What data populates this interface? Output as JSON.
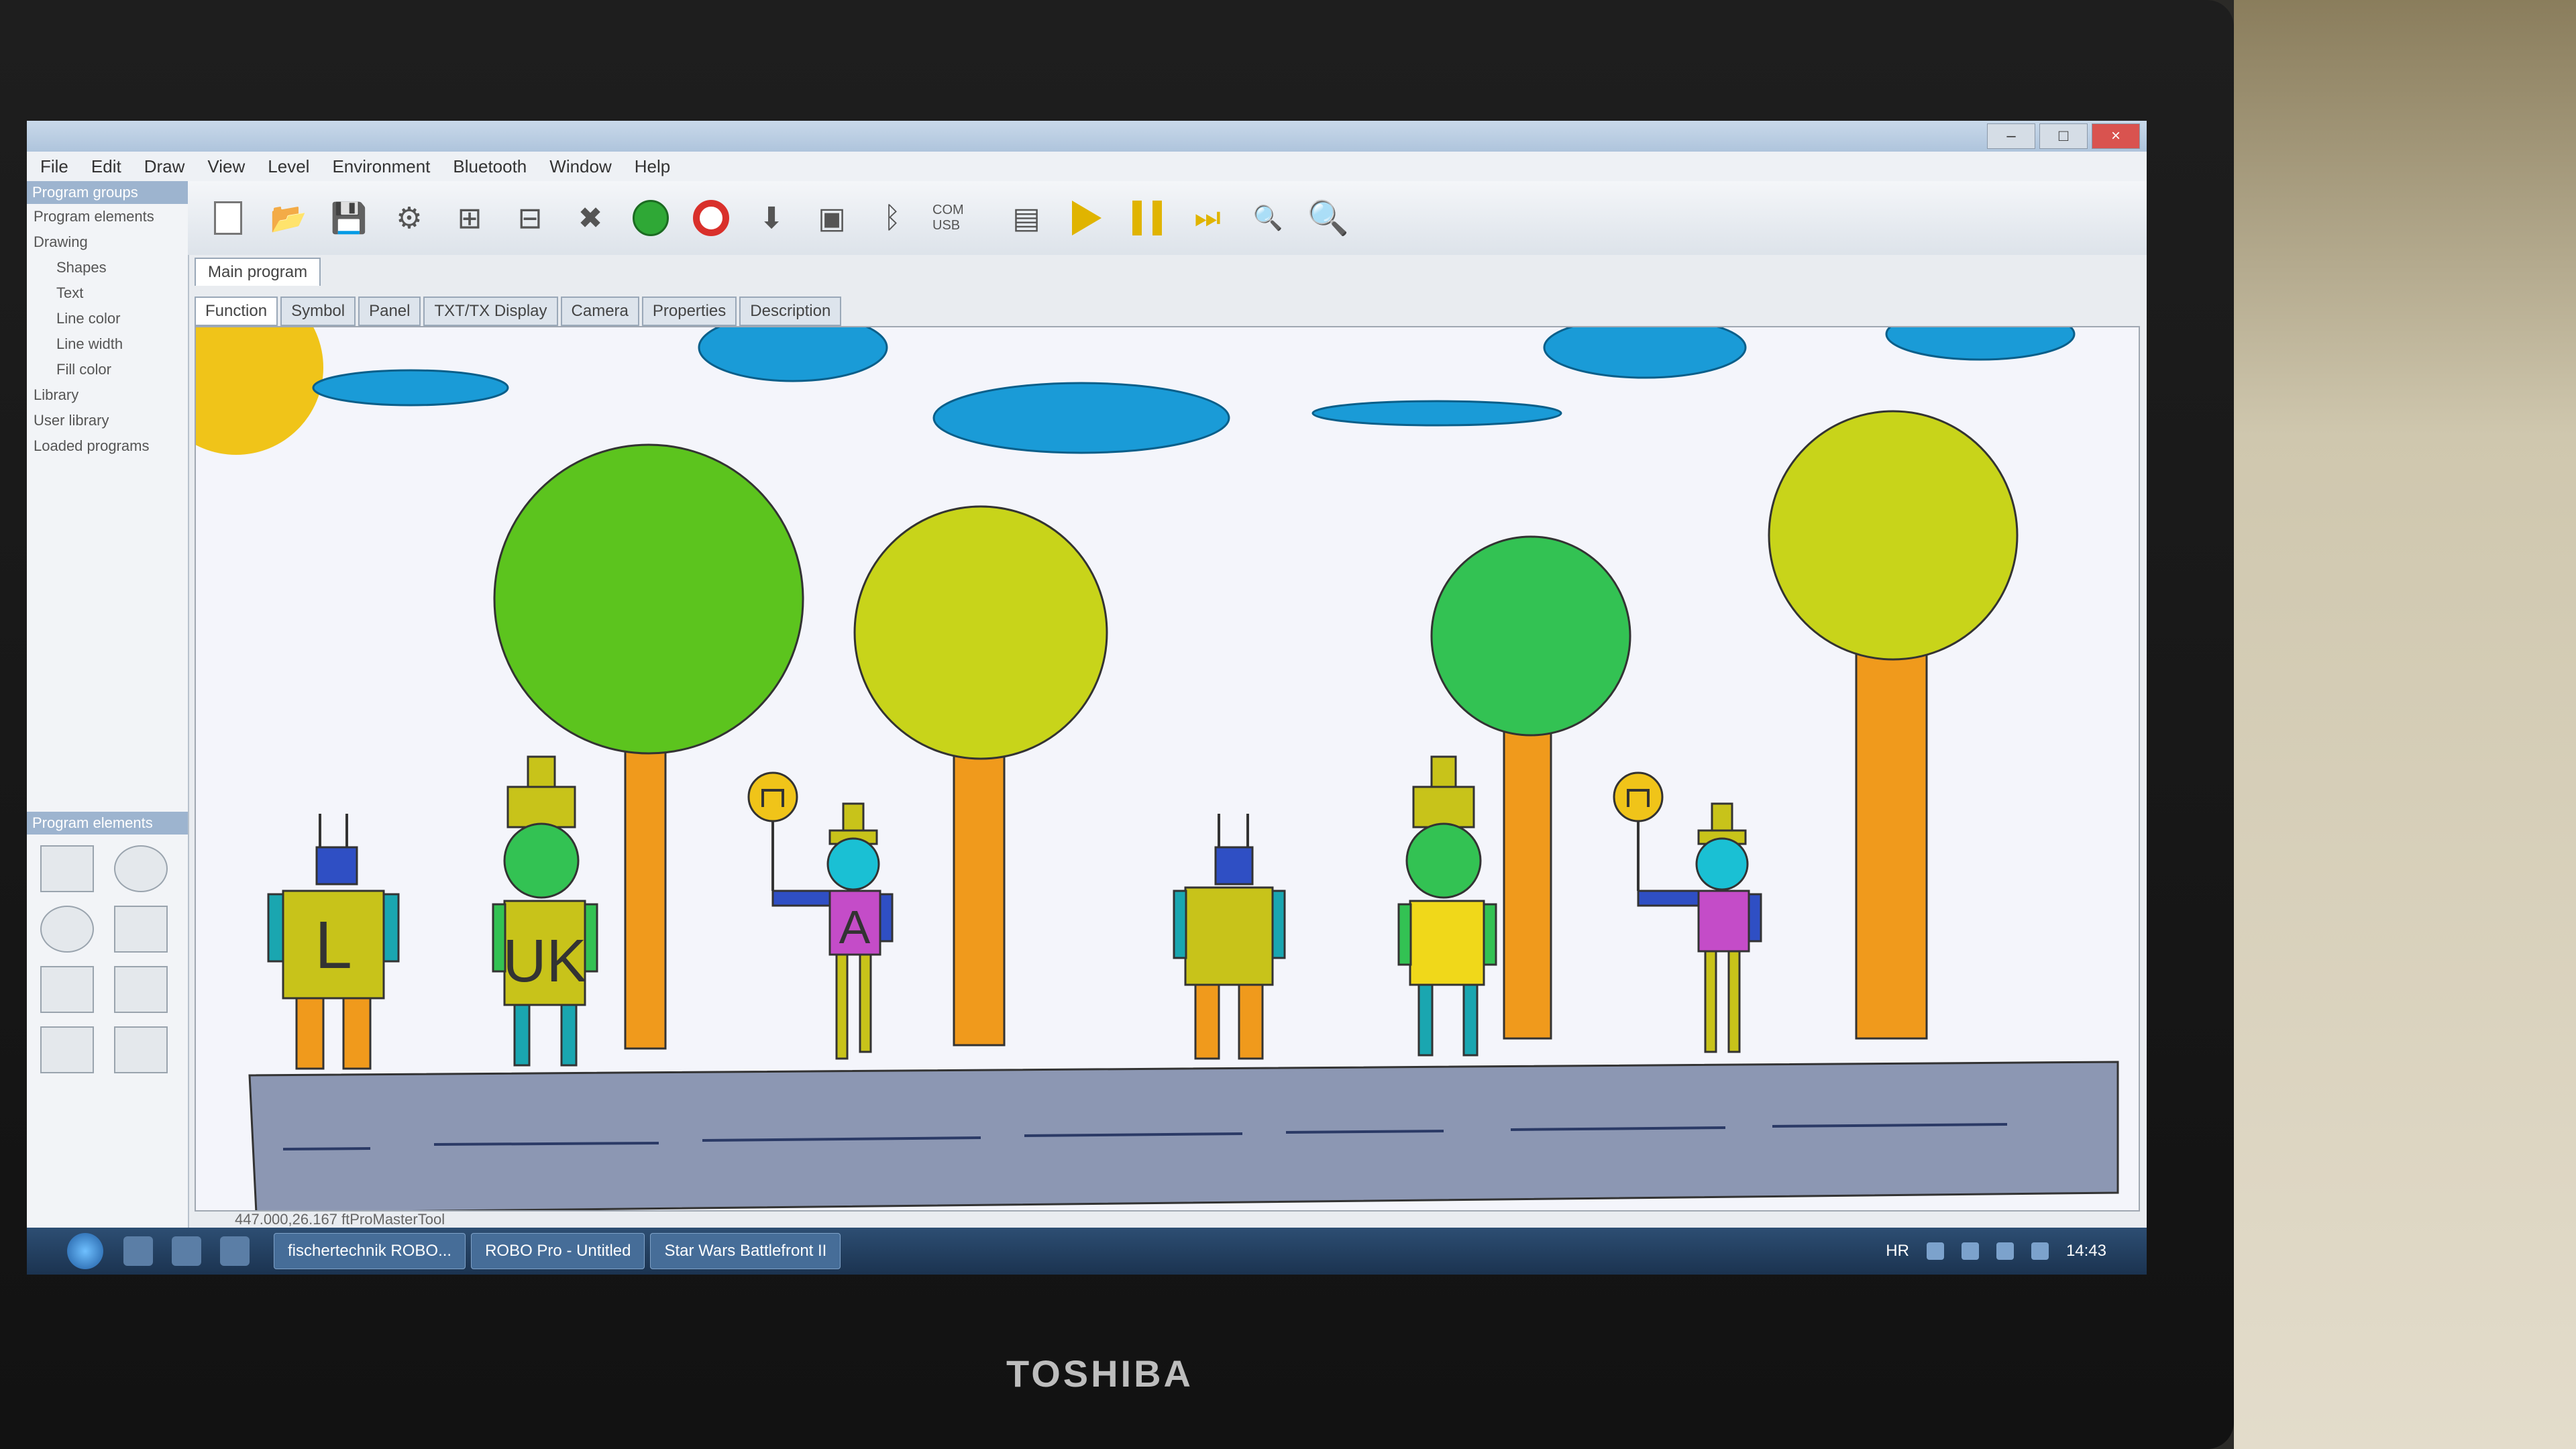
{
  "laptop_brand": "TOSHIBA",
  "window": {
    "buttons": {
      "minimize": "–",
      "maximize": "□",
      "close": "×"
    }
  },
  "menu": [
    "File",
    "Edit",
    "Draw",
    "View",
    "Level",
    "Environment",
    "Bluetooth",
    "Window",
    "Help"
  ],
  "toolbar": {
    "icons": [
      "new-file-icon",
      "open-folder-icon",
      "save-icon",
      "robot-icon",
      "split-icon",
      "table-icon",
      "delete-icon",
      "start-icon",
      "stop-icon",
      "download-icon",
      "interface-icon",
      "bluetooth-icon",
      "com-usb-icon",
      "window-icon",
      "play-icon",
      "pause-icon",
      "step-icon",
      "zoom-out-icon",
      "zoom-in-icon"
    ],
    "com_label": "COM USB"
  },
  "left_panel": {
    "title": "Program groups",
    "items": [
      "Program elements",
      "Drawing"
    ],
    "sub_items": [
      "Shapes",
      "Text",
      "Line color",
      "Line width",
      "Fill color"
    ],
    "tail_items": [
      "Library",
      "User library",
      "Loaded programs"
    ],
    "palette_title": "Program elements"
  },
  "document_tab": "Main program",
  "subtabs": [
    "Function",
    "Symbol",
    "Panel",
    "TXT/TX Display",
    "Camera",
    "Properties",
    "Description"
  ],
  "active_subtab": "Function",
  "drawing": {
    "figure_texts": {
      "robot1": "L",
      "robot2": "UK",
      "robot3": "A"
    },
    "colors": {
      "sky": "#f4f5fb",
      "cloud": "#1a9bd7",
      "sun": "#f0c419",
      "tree_green": "#5cc41e",
      "tree_yellow": "#c8d41a",
      "tree_teal": "#33c253",
      "trunk": "#f09a1c",
      "road": "#8c97b3"
    }
  },
  "status_text": "447.000,26.167  ftProMasterTool",
  "taskbar": {
    "buttons": [
      "fischertechnik ROBO...",
      "ROBO Pro - Untitled",
      "Star Wars Battlefront II"
    ],
    "language": "HR",
    "clock": "14:43"
  }
}
